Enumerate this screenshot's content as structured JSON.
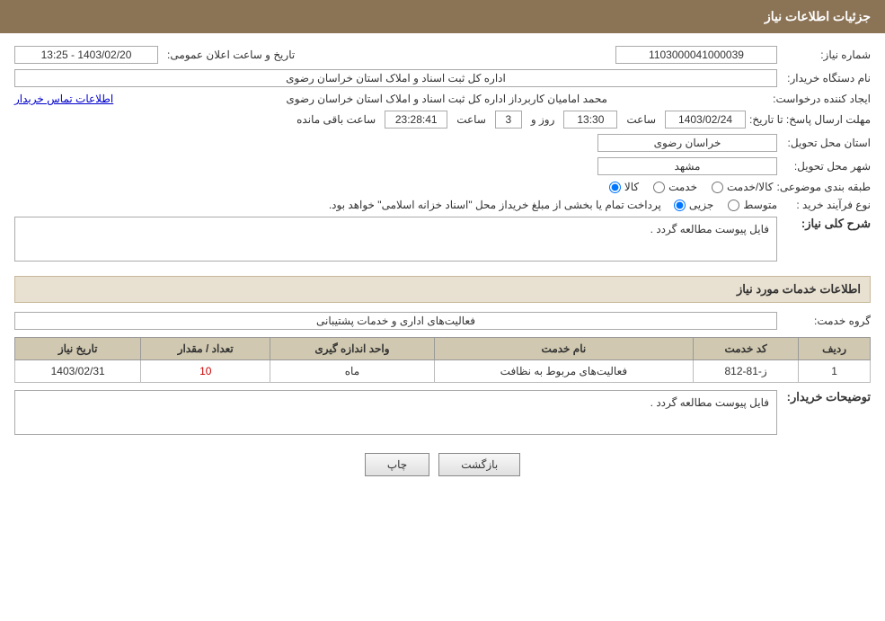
{
  "header": {
    "title": "جزئیات اطلاعات نیاز"
  },
  "fields": {
    "need_number_label": "شماره نیاز:",
    "need_number_value": "1103000041000039",
    "announce_date_label": "تاریخ و ساعت اعلان عمومی:",
    "announce_date_value": "1403/02/20 - 13:25",
    "buyer_org_label": "نام دستگاه خریدار:",
    "buyer_org_value": "اداره کل ثبت اسناد و املاک استان خراسان رضوی",
    "creator_label": "ایجاد کننده درخواست:",
    "creator_value": "محمد امامیان کاربرداز اداره کل ثبت اسناد و املاک استان خراسان رضوی",
    "creator_link": "اطلاعات تماس خریدار",
    "reply_deadline_label": "مهلت ارسال پاسخ: تا تاریخ:",
    "reply_date_value": "1403/02/24",
    "reply_time_label": "ساعت",
    "reply_time_value": "13:30",
    "remaining_label": "روز و",
    "remaining_days": "3",
    "remaining_time": "23:28:41",
    "remaining_suffix": "ساعت باقی مانده",
    "province_label": "استان محل تحویل:",
    "province_value": "خراسان رضوی",
    "city_label": "شهر محل تحویل:",
    "city_value": "مشهد",
    "category_label": "طبقه بندی موضوعی:",
    "category_kala": "کالا",
    "category_khedmat": "خدمت",
    "category_kala_khedmat": "کالا/خدمت",
    "process_label": "نوع فرآیند خرید :",
    "process_jozi": "جزیی",
    "process_motavasset": "متوسط",
    "process_description": "پرداخت تمام یا بخشی از مبلغ خریداز محل \"اسناد خزانه اسلامی\" خواهد بود.",
    "general_description_section": "شرح کلی نیاز:",
    "general_description_value": "فایل پیوست مطالعه گردد .",
    "services_section": "اطلاعات خدمات مورد نیاز",
    "service_group_label": "گروه خدمت:",
    "service_group_value": "فعالیت‌های اداری و خدمات پشتیبانی",
    "table_headers": {
      "row_num": "ردیف",
      "service_code": "کد خدمت",
      "service_name": "نام خدمت",
      "unit": "واحد اندازه گیری",
      "quantity": "تعداد / مقدار",
      "date": "تاریخ نیاز"
    },
    "table_rows": [
      {
        "row_num": "1",
        "service_code": "ز-81-812",
        "service_name": "فعالیت‌های مربوط به نظافت",
        "unit": "ماه",
        "quantity": "10",
        "date": "1403/02/31"
      }
    ],
    "buyer_description_section": "توضیحات خریدار:",
    "buyer_description_value": "فایل پیوست مطالعه گردد .",
    "btn_print": "چاپ",
    "btn_back": "بازگشت"
  }
}
